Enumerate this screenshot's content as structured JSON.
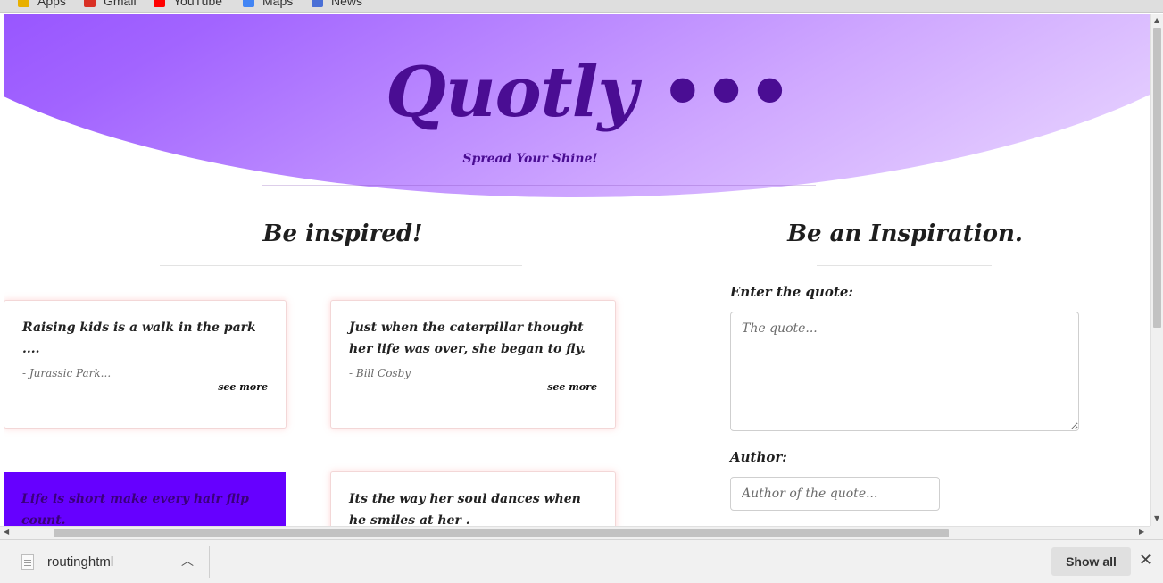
{
  "bookmarks": [
    {
      "label": "Apps",
      "icon": "apps-icon",
      "color": "#e8b000"
    },
    {
      "label": "Gmail",
      "icon": "gmail-icon",
      "color": "#d93025"
    },
    {
      "label": "YouTube",
      "icon": "youtube-icon",
      "color": "#ff0000"
    },
    {
      "label": "Maps",
      "icon": "maps-icon",
      "color": "#4285f4"
    },
    {
      "label": "News",
      "icon": "news-icon",
      "color": "#4a6fd6"
    }
  ],
  "hero": {
    "logo": "Quotly •••",
    "tagline": "Spread Your Shine!"
  },
  "inspired": {
    "title": "Be inspired!",
    "cards": [
      {
        "quote": "Raising kids is a walk in the park ....",
        "author": "- Jurassic Park...",
        "more": "see more",
        "highlight": false
      },
      {
        "quote": "Just when the caterpillar thought her life was over, she began to fly.",
        "author": "- Bill Cosby",
        "more": "see more",
        "highlight": false
      },
      {
        "quote": "Life is short make every hair flip count.",
        "author": "",
        "more": "",
        "highlight": true
      },
      {
        "quote": "Its the way her soul dances when he smiles at her .",
        "author": "",
        "more": "",
        "highlight": false
      }
    ]
  },
  "inspiration": {
    "title": "Be an Inspiration.",
    "quote_label": "Enter the quote:",
    "quote_placeholder": "The quote...",
    "author_label": "Author:",
    "author_placeholder": "Author of the quote..."
  },
  "downloads": {
    "filename": "routinghtml",
    "show_all": "Show all",
    "close": "✕"
  },
  "colors": {
    "accent": "#6600ff",
    "logo": "#4a0d93"
  }
}
